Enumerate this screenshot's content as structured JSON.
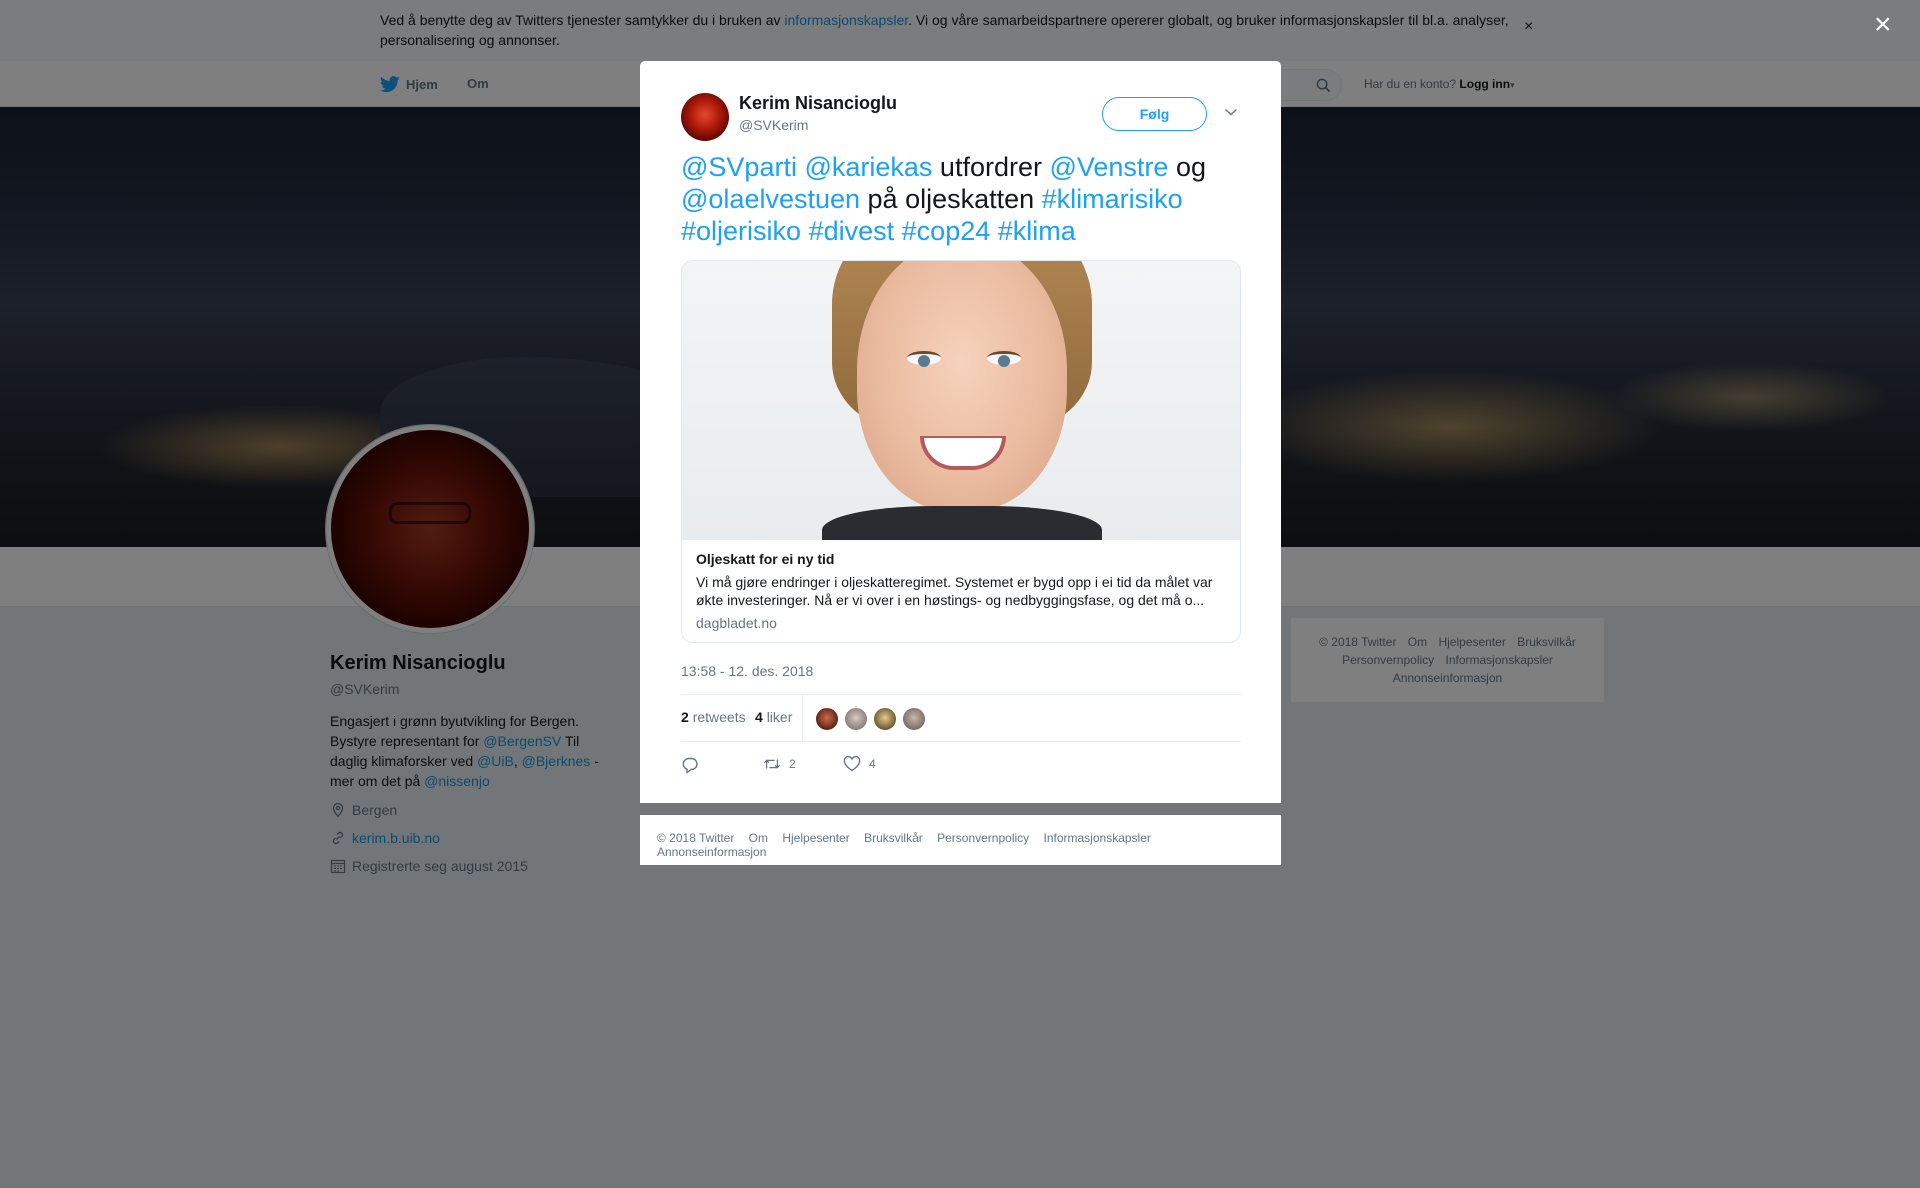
{
  "cookie_banner": {
    "text_before": "Ved å benytte deg av Twitters tjenester samtykker du i bruken av ",
    "link": "informasjonskapsler",
    "text_after": ". Vi og våre samarbeidspartnere opererer globalt, og bruker informasjonskapsler til bl.a. analyser, personalisering og annonser.",
    "close": "×"
  },
  "topnav": {
    "home": "Hjem",
    "about": "Om",
    "login_prompt": "Har du en konto?",
    "login": "Logg inn"
  },
  "profile": {
    "name": "Kerim Nisancioglu",
    "handle": "@SVKerim",
    "bio_1": "Engasjert i grønn byutvikling for Bergen. Bystyre representant for ",
    "bio_link1": "@BergenSV",
    "bio_2": " Til daglig klimaforsker ved ",
    "bio_link2": "@UiB",
    "bio_3": ", ",
    "bio_link3": "@Bjerknes",
    "bio_4": " - mer om det på ",
    "bio_link4": "@nissenjo",
    "location": "Bergen",
    "url": "kerim.b.uib.no",
    "joined": "Registrerte seg august 2015"
  },
  "side_footer": {
    "items": [
      "© 2018 Twitter",
      "Om",
      "Hjelpesenter",
      "Bruksvilkår",
      "Personvernpolicy",
      "Informasjonskapsler",
      "Annonseinformasjon"
    ]
  },
  "overlay_close": "×",
  "tweet": {
    "author_name": "Kerim Nisancioglu",
    "author_handle": "@SVKerim",
    "follow": "Følg",
    "t1": "@SVparti",
    "t2": "@kariekas",
    "t3": " utfordrer ",
    "t4": "@Venstre",
    "t5": " og ",
    "t6": "@olaelvestuen",
    "t7": " på oljeskatten ",
    "t8": "#klimarisiko",
    "t9": "#oljerisiko",
    "t10": "#divest",
    "t11": "#cop24",
    "t12": "#klima",
    "card": {
      "title": "Oljeskatt for ei ny tid",
      "description": "Vi må gjøre endringer i oljeskatteregimet. Systemet er bygd opp i ei tid da målet var økte investeringer. Nå er vi over i en høstings- og nedbyggingsfase, og det må o...",
      "domain": "dagbladet.no"
    },
    "timestamp": "13:58 - 12. des. 2018",
    "retweets_count": "2",
    "retweets_label": "retweets",
    "likes_count": "4",
    "likes_label": "liker",
    "action_retweet_count": "2",
    "action_like_count": "4"
  },
  "modal_footer": {
    "items": [
      "© 2018 Twitter",
      "Om",
      "Hjelpesenter",
      "Bruksvilkår",
      "Personvernpolicy",
      "Informasjonskapsler",
      "Annonseinformasjon"
    ]
  },
  "colors": {
    "brand": "#1da1f2",
    "link": "#1b95e0",
    "background": "#e6ecf0"
  }
}
